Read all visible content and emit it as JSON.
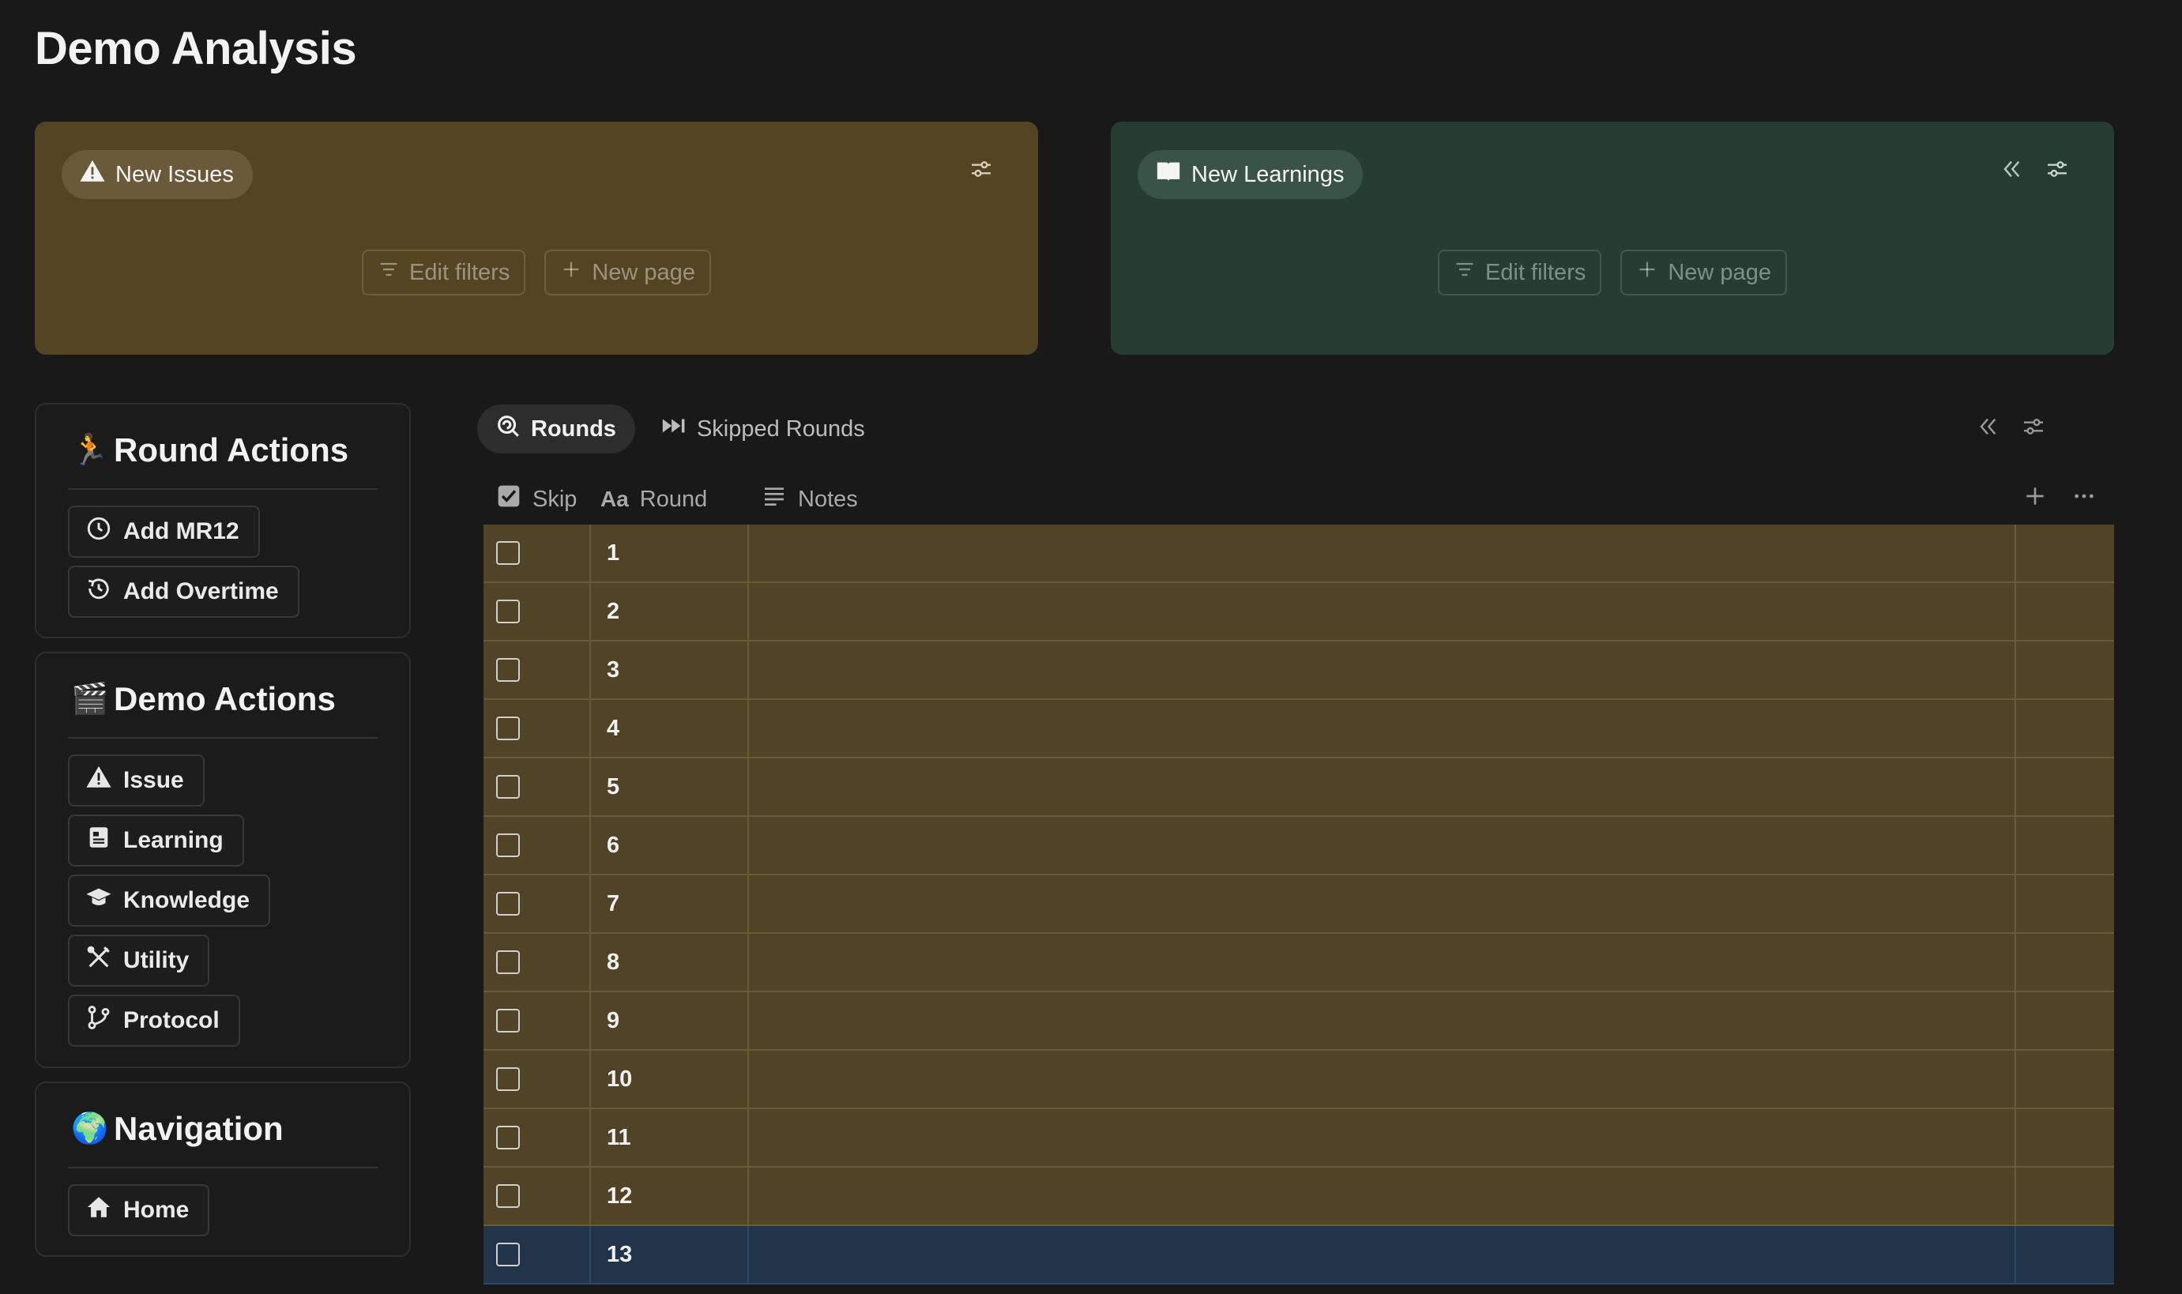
{
  "page_title": "Demo Analysis",
  "issues_card": {
    "label": "New Issues",
    "edit_filters": "Edit filters",
    "new_page": "New page",
    "color": "#534522"
  },
  "learnings_card": {
    "label": "New Learnings",
    "edit_filters": "Edit filters",
    "new_page": "New page",
    "color": "#253d32"
  },
  "round_actions": {
    "title": "Round Actions",
    "emoji": "🏃",
    "buttons": [
      {
        "label": "Add MR12",
        "icon": "clock-icon"
      },
      {
        "label": "Add Overtime",
        "icon": "history-icon"
      }
    ]
  },
  "demo_actions": {
    "title": "Demo Actions",
    "emoji": "🎬",
    "buttons": [
      {
        "label": "Issue",
        "icon": "warning-icon"
      },
      {
        "label": "Learning",
        "icon": "notebook-icon"
      },
      {
        "label": "Knowledge",
        "icon": "graduation-cap-icon"
      },
      {
        "label": "Utility",
        "icon": "tools-icon"
      },
      {
        "label": "Protocol",
        "icon": "branch-icon"
      }
    ]
  },
  "navigation": {
    "title": "Navigation",
    "emoji": "🌍",
    "buttons": [
      {
        "label": "Home",
        "icon": "home-icon"
      }
    ]
  },
  "tabs": [
    {
      "label": "Rounds",
      "icon": "search-refresh-icon",
      "active": true
    },
    {
      "label": "Skipped Rounds",
      "icon": "fast-forward-icon",
      "active": false
    }
  ],
  "table": {
    "columns": [
      {
        "label": "Skip",
        "icon": "checkbox-icon"
      },
      {
        "label": "Round",
        "icon": "text-type-icon"
      },
      {
        "label": "Notes",
        "icon": "lines-icon"
      }
    ],
    "rows": [
      {
        "round": "1",
        "skip": false,
        "highlight": "gold"
      },
      {
        "round": "2",
        "skip": false,
        "highlight": "gold"
      },
      {
        "round": "3",
        "skip": false,
        "highlight": "gold"
      },
      {
        "round": "4",
        "skip": false,
        "highlight": "gold"
      },
      {
        "round": "5",
        "skip": false,
        "highlight": "gold"
      },
      {
        "round": "6",
        "skip": false,
        "highlight": "gold"
      },
      {
        "round": "7",
        "skip": false,
        "highlight": "gold"
      },
      {
        "round": "8",
        "skip": false,
        "highlight": "gold"
      },
      {
        "round": "9",
        "skip": false,
        "highlight": "gold"
      },
      {
        "round": "10",
        "skip": false,
        "highlight": "gold"
      },
      {
        "round": "11",
        "skip": false,
        "highlight": "gold"
      },
      {
        "round": "12",
        "skip": false,
        "highlight": "gold"
      },
      {
        "round": "13",
        "skip": false,
        "highlight": "blue"
      }
    ]
  }
}
